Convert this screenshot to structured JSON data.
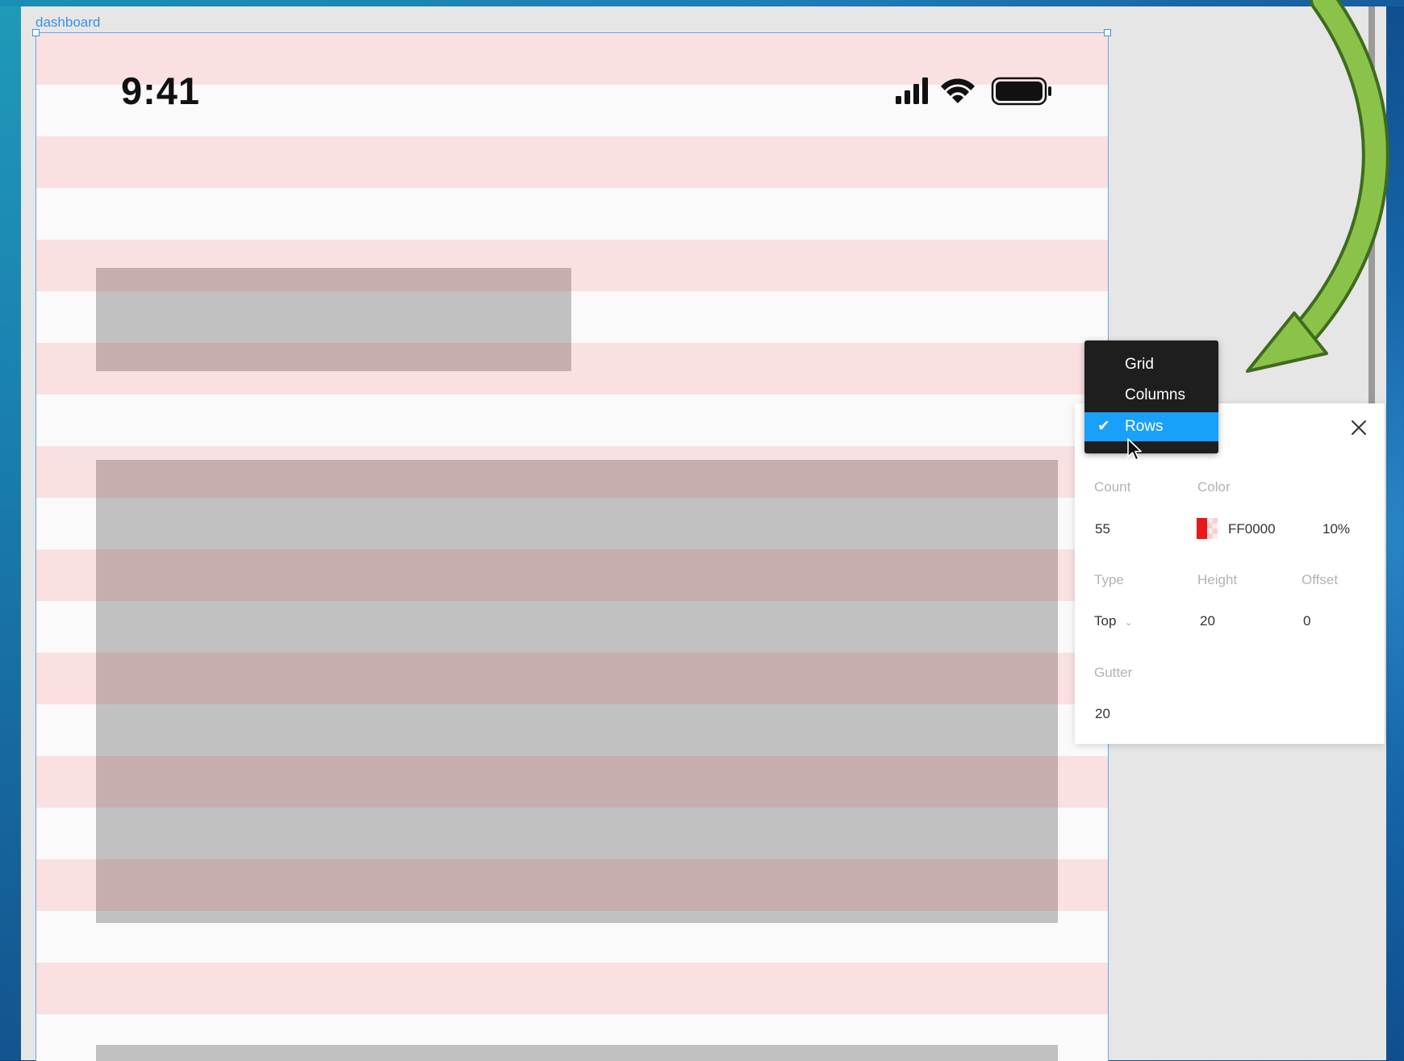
{
  "frame": {
    "label": "dashboard"
  },
  "status_bar": {
    "time": "9:41",
    "icons": [
      "signal-icon",
      "wifi-icon",
      "battery-icon"
    ]
  },
  "grid_overlay": {
    "color": "#FF0000",
    "opacity": "10%"
  },
  "layout_type_menu": {
    "items": [
      {
        "label": "Grid",
        "selected": false
      },
      {
        "label": "Columns",
        "selected": false
      },
      {
        "label": "Rows",
        "selected": true
      }
    ]
  },
  "grid_panel": {
    "count_label": "Count",
    "count_value": "55",
    "color_label": "Color",
    "color_hex": "FF0000",
    "color_opacity": "10%",
    "type_label": "Type",
    "type_value": "Top",
    "height_label": "Height",
    "height_value": "20",
    "offset_label": "Offset",
    "offset_value": "0",
    "gutter_label": "Gutter",
    "gutter_value": "20"
  },
  "colors": {
    "selection": "#18A0FB",
    "menu_bg": "#1E1E1E",
    "annotation_arrow": "#8BC34A"
  }
}
